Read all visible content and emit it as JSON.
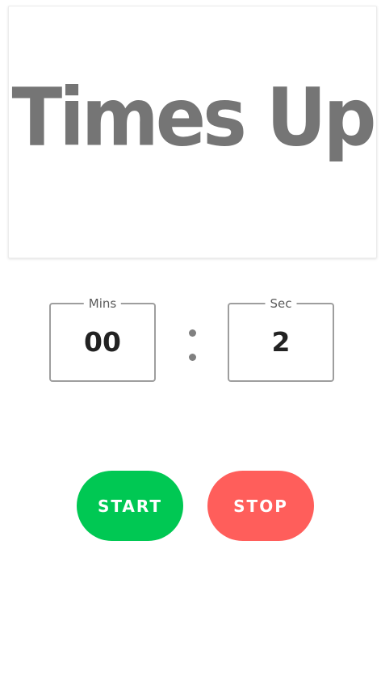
{
  "display": {
    "text": "Times Up"
  },
  "timer": {
    "mins_label": "Mins",
    "mins_value": "00",
    "secs_label": "Sec",
    "secs_value": "2"
  },
  "buttons": {
    "start_label": "START",
    "stop_label": "STOP"
  },
  "colors": {
    "start": "#00c853",
    "stop": "#ff5e5b",
    "display_text": "#757575"
  }
}
